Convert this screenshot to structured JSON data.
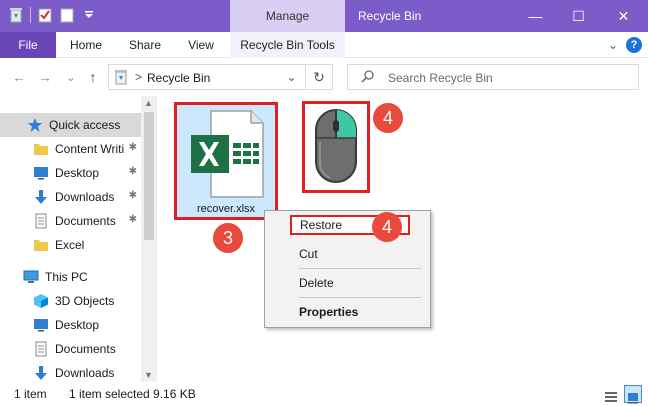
{
  "window": {
    "title": "Recycle Bin",
    "context_tab": "Manage",
    "minimize": "—",
    "maximize": "☐",
    "close": "✕"
  },
  "ribbon": {
    "tabs": [
      "File",
      "Home",
      "Share",
      "View",
      "Recycle Bin Tools"
    ],
    "collapse": "⌄",
    "help": "?"
  },
  "address": {
    "back": "←",
    "forward": "→",
    "recent": "⌄",
    "up": "↑",
    "chevron": ">",
    "path": "Recycle Bin",
    "dropdown": "⌄",
    "refresh": "↻",
    "search_placeholder": "Search Recycle Bin"
  },
  "sidebar": {
    "items": [
      {
        "label": "Quick access",
        "icon": "star-icon",
        "pinned": false,
        "selected": true
      },
      {
        "label": "Content Writi",
        "icon": "folder-icon",
        "pinned": true
      },
      {
        "label": "Desktop",
        "icon": "desktop-icon",
        "pinned": true
      },
      {
        "label": "Downloads",
        "icon": "download-icon",
        "pinned": true
      },
      {
        "label": "Documents",
        "icon": "document-icon",
        "pinned": true
      },
      {
        "label": "Excel",
        "icon": "folder-icon",
        "pinned": false
      },
      {
        "label": "This PC",
        "icon": "computer-icon",
        "pinned": false
      },
      {
        "label": "3D Objects",
        "icon": "cube-icon",
        "pinned": false
      },
      {
        "label": "Desktop",
        "icon": "desktop-icon",
        "pinned": false
      },
      {
        "label": "Documents",
        "icon": "document-icon",
        "pinned": false
      },
      {
        "label": "Downloads",
        "icon": "download-icon",
        "pinned": false
      }
    ],
    "pin_glyph": "📌"
  },
  "main": {
    "file_name": "recover.xlsx",
    "badge_file": "3",
    "badge_mouse": "4",
    "badge_menu": "4"
  },
  "context_menu": {
    "items": [
      "Restore",
      "Cut",
      "Delete",
      "Properties"
    ]
  },
  "status": {
    "count": "1 item",
    "selection": "1 item selected  9.16 KB"
  },
  "colors": {
    "titlebar": "#7b5cc8",
    "file_tab": "#6a45b8",
    "highlight_red": "#e02020",
    "badge_red": "#e84a3d",
    "selection_blue": "#cce8ff",
    "excel_green": "#1e7145"
  }
}
